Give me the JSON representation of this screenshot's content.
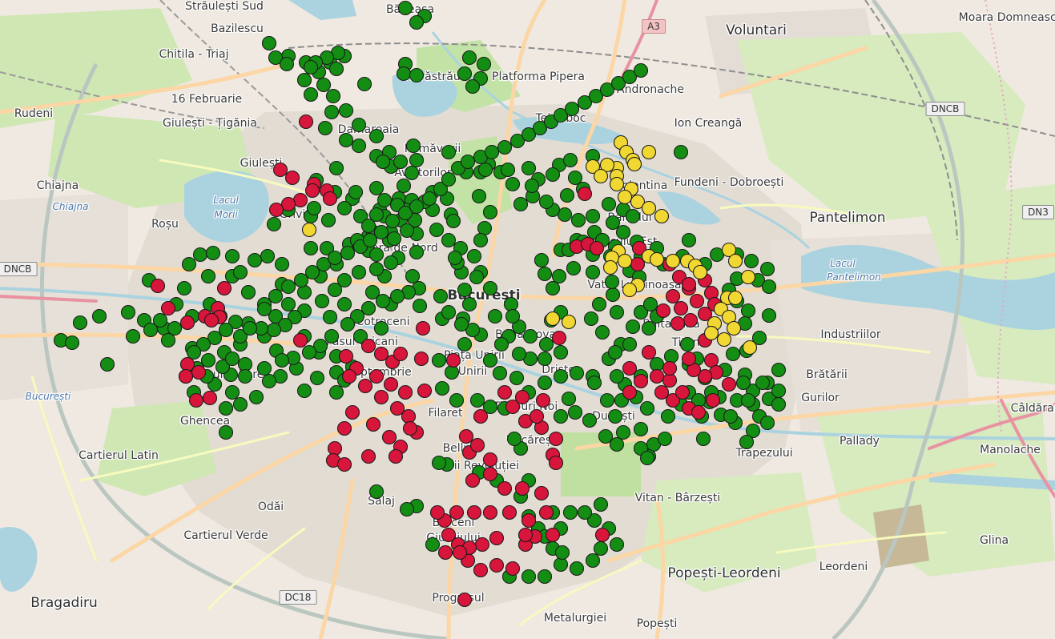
{
  "map": {
    "colors": {
      "land": "#efe9e1",
      "green": "#c8e3a8",
      "water": "#aad3df",
      "road": "#f7fabf",
      "primary": "#fcd6a4",
      "motorway": "#e892a2",
      "rail": "#9a9a9a",
      "marker_green": "#138e13",
      "marker_red": "#d8153a",
      "marker_yellow": "#f1d731",
      "marker_stroke": "#1b1b1b"
    },
    "labels": [
      {
        "text": "Străulești Sud"
      },
      {
        "text": "Băneasa"
      },
      {
        "text": "Voluntari",
        "cls": "big"
      },
      {
        "text": "Moara Domnească"
      },
      {
        "text": "Bazilescu"
      },
      {
        "text": "Chitila - Triaj"
      },
      {
        "text": "Herăstrău"
      },
      {
        "text": "Platforma Pipera"
      },
      {
        "text": "Andronache"
      },
      {
        "text": "Rudeni"
      },
      {
        "text": "16 Februarie"
      },
      {
        "text": "Giulești - Țigănia"
      },
      {
        "text": "Tei Toboc"
      },
      {
        "text": "Ion Creangă"
      },
      {
        "text": "Damaroaia"
      },
      {
        "text": "Primăverii"
      },
      {
        "text": "Aviatorilor"
      },
      {
        "text": "Giulești"
      },
      {
        "text": "Fundeni - Dobroești"
      },
      {
        "text": "Chiajna"
      },
      {
        "text": "Chiajna",
        "cls": "lake"
      },
      {
        "text": "Lacul",
        "cls": "lake"
      },
      {
        "text": "Morii",
        "cls": "lake"
      },
      {
        "text": "Grivița"
      },
      {
        "text": "Colentina"
      },
      {
        "text": "Baicului"
      },
      {
        "text": "Roșu"
      },
      {
        "text": "Pantelimon",
        "cls": "big"
      },
      {
        "text": "Gara de Nord"
      },
      {
        "text": "Iancului Est"
      },
      {
        "text": "Lacul",
        "cls": "lake"
      },
      {
        "text": "Pantelimon",
        "cls": "lake"
      },
      {
        "text": "Drumul Taberei"
      },
      {
        "text": "Vatra Luminoasă"
      },
      {
        "text": "București",
        "cls": "center"
      },
      {
        "text": "Cotroceni"
      },
      {
        "text": "Industriilor"
      },
      {
        "text": "Baba Novac"
      },
      {
        "text": "Balta Albă"
      },
      {
        "text": "Titan"
      },
      {
        "text": "Pasul Uricani"
      },
      {
        "text": "Dristor"
      },
      {
        "text": "Unirii"
      },
      {
        "text": "Piața Unirii"
      },
      {
        "text": "13 Septembrie"
      },
      {
        "text": "Brătării"
      },
      {
        "text": "Gurilor"
      },
      {
        "text": "Ghencea"
      },
      {
        "text": "Filaret"
      },
      {
        "text": "Timpuri Noi"
      },
      {
        "text": "Dudești"
      },
      {
        "text": "Trapezului"
      },
      {
        "text": "Pallady"
      },
      {
        "text": "Câldăraru"
      },
      {
        "text": "Manolache"
      },
      {
        "text": "Bellu"
      },
      {
        "text": "Eroii Revoluției"
      },
      {
        "text": "Văcărești"
      },
      {
        "text": "Cartierul Latin"
      },
      {
        "text": "București",
        "cls": "lake"
      },
      {
        "text": "Odăi"
      },
      {
        "text": "Sălaj"
      },
      {
        "text": "Berceni"
      },
      {
        "text": "Vitan - Bârzești"
      },
      {
        "text": "Cartierul Verde"
      },
      {
        "text": "Giurgiului"
      },
      {
        "text": "Popești-Leordeni",
        "cls": "big"
      },
      {
        "text": "Leordeni"
      },
      {
        "text": "Glina"
      },
      {
        "text": "Bragadiru",
        "cls": "big"
      },
      {
        "text": "Progresul"
      },
      {
        "text": "Metalurgiei"
      },
      {
        "text": "Popești"
      }
    ],
    "shields": [
      {
        "text": "A3",
        "cls": "motor"
      },
      {
        "text": "DNCB",
        "cls": "nat"
      },
      {
        "text": "DNCB",
        "cls": "nat"
      },
      {
        "text": "DN3",
        "cls": "nat"
      },
      {
        "text": "DC18",
        "cls": "nat"
      }
    ]
  },
  "markers": {
    "green": "a360,70;412,78;398,90;380,100;404,106;388,118;455,105;414,140;406,160;432,175;448,182;470,195;488,208;420,210;395,225;470,235;440,248;474,262;500,275;520,292;486,300;460,313;497,322;515,345;480,345;465,365;488,380;430,380;412,396;450,420;476,410;524,382;552,398;578,398;600,418;635,420;648,408;662,420;682,430;662,448;648,442;626,430;612,450;624,466;645,472;660,490;680,478;700,470;720,466;740,470;760,448;775,430;790,408;800,390;812,380;820,395;810,410;786,430;768,440;752,415;738,398;748,380;770,390;765,368;764,352;740,340;716,335;698,345;690,360;680,342;676,325;700,312;720,300;742,290;765,278;740,270;722,275;705,268;690,262;682,252;665,245;650,255;640,230;625,215;610,205;600,215;598,245;612,265;605,285;600,300;592,320;576,340;600,340;612,360;638,380;618,395;590,412;571,328;518,275;540,262;563,268;545,287;520,315;504,232;514,216;486,190;516,182;480,250;450,270;460,295;436,305;408,310;388,310;420,330;400,345;380,365;360,380;344,395;330,420;345,438;380,420;398,440;420,445;420,465;396,472;370,460;350,470;330,460;306,455;300,430;280,440;260,450;240,435;232,470;242,490;268,480;290,490;282,510;275,395;262,380;240,395;220,380;205,410;230,360;260,345;290,345;310,365;330,380;352,355;352,330;334,320;318,325;300,340;290,320;342,280;360,262;388,270;410,275;430,260;444,240;418,240;392,260;306,470;288,468;430,475;440,458;380,488;420,490;236,330;250,318;266,316;186,350;160,390;180,400;200,400;124,395;100,403;76,425;90,428;166,420;188,412;134,455;210,425;218,410;586,72;604,80;580,92;600,98;590,108;560,190;582,215;606,212;634,212;660,210;672,224;698,206;690,218;712,200;740,195;718,222;728,236;708,244;664,232;760,255;778,262;790,270;778,290;795,302;800,320;768,308;752,300;728,302;710,312;740,318;762,320;786,338;798,346;820,310;828,330;852,320;860,300;850,190;880,330;895,318;920,318;938,326;958,336;946,350;960,358;920,348;910,362;920,376;934,388;930,404;960,394;948,422;932,438;915,442;905,462;930,468;940,488;940,505;960,498;948,520;972,505;972,488;972,462;958,478;920,500;900,518;918,528;940,538;958,528;886,502;876,520;850,505;834,520;808,510;794,496;776,500;768,520;778,540;800,536;816,555;810,570;770,555;756,545;736,525;718,515;700,520;710,498;742,478;758,500;780,480;800,470;820,455;838,445;858,430;860,455;870,448;880,472;860,490;770,470;700,440;680,448;688,400;700,390;640,395;630,510;612,508;596,500;570,500;552,485;564,465;548,450;580,430;576,405;598,590;620,600;650,620;660,645;672,660;680,670;690,685;700,705;720,710;740,700;750,685;770,680;760,660;742,650;750,630;730,640;712,640;700,660;702,690;680,720;660,720;636,720;690,640;660,600;650,560;642,548;558,580;548,578;520,632;508,636;540,680;470,614;530,20;520,28;506,10;506,80;504,92;520,94;480,270;498,248;518,255;530,252;540,240;558,248;566,276;560,300;575,310;568,322;595,346;580,362;586,380;560,390;550,370;523,360;510,365;496,370;478,376;460,385;446,395;434,405;414,420;400,432;386,440;366,447;352,450;336,476;320,496;300,505;282,540;800,560;830,548;808,572;878,548;932,552;912,520;934,500;952,478;928,478;898,496;888,490;872,500;336,54;344,72;358,80;382,78;420,86;430,70;422,66;408,72;394,78;388,84;416,120;432,138;448,156;470,170;478,202;500,202;520,200;514,250;488,290;466,290;448,305;492,298;508,288;506,262;496,256;470,268;460,282;446,300;470,318;488,328;470,336;448,340;430,350;418,362;402,376;380,388;368,396;356,406;342,412;326,410;310,404;294,402;282,412;268,422;254,430;242,440;246,460;258,470;278,458;290,448;300,420;312,410;330,386;344,370;360,358;376,350;390,340;404,330;418,322;434,316;450,308;462,300;476,290;490,276;506,266;520,258;536,248;550,236;560,224;572,210;584,202;600,196;614,190;630,184;646,176;660,168;674,160;688,152;700,144;714,136;730,128;744,120;758,112;772,104;786,96;800,88",
    "red": "a382,152;350,212;365,222;392,230;408,238;412,248;390,238;375,250;360,255;345,262;197,357;210,385;234,403;256,395;280,360;272,385;274,396;264,400;234,455;248,465;232,470;245,500;262,497;375,425;432,445;445,460;460,432;476,442;490,452;500,442;526,448;436,470;456,482;476,496;496,510;510,520;520,540;500,558;486,546;466,530;440,515;430,535;418,560;416,575;430,580;460,570;494,570;512,535;530,488;506,490;488,480;470,470;528,410;566,450;600,520;582,545;586,565;630,490;652,496;678,500;640,508;656,526;676,534;670,520;694,548;690,568;694,578;612,592;630,610;652,610;676,616;682,640;660,650;636,640;612,640;592,640;570,640;555,650;560,668;572,680;584,700;600,712;620,706;640,710;656,680;668,670;690,668;656,668;620,672;602,680;586,684;574,690;556,690;546,640;580,749;698,422;730,242;720,308;734,305;745,310;798,310;796,330;836,330;848,346;860,360;870,376;880,392;862,400;846,404;828,388;840,370;850,385;860,355;880,350;888,366;892,380;880,425;888,450;894,465;880,470;866,462;836,475;826,490;840,500;852,490;860,510;872,515;890,500;910,480;860,448;836,460;820,470;800,476;786,460;786,490;810,440;752,668;590,600;612,574;596,556",
    "yellow": "a775,178;782,190;790,200;810,190;792,205;770,210;758,206;740,208;750,220;770,220;770,230;788,236;780,246;796,252;810,260;826,270;772,314;764,322;780,326;762,334;810,320;820,324;840,326;858,326;868,332;874,340;910,312;918,326;934,346;908,372;918,372;900,386;910,396;892,404;888,416;904,424;916,410;936,434;710,402;690,398;796,356;786,362;386,287"
  }
}
